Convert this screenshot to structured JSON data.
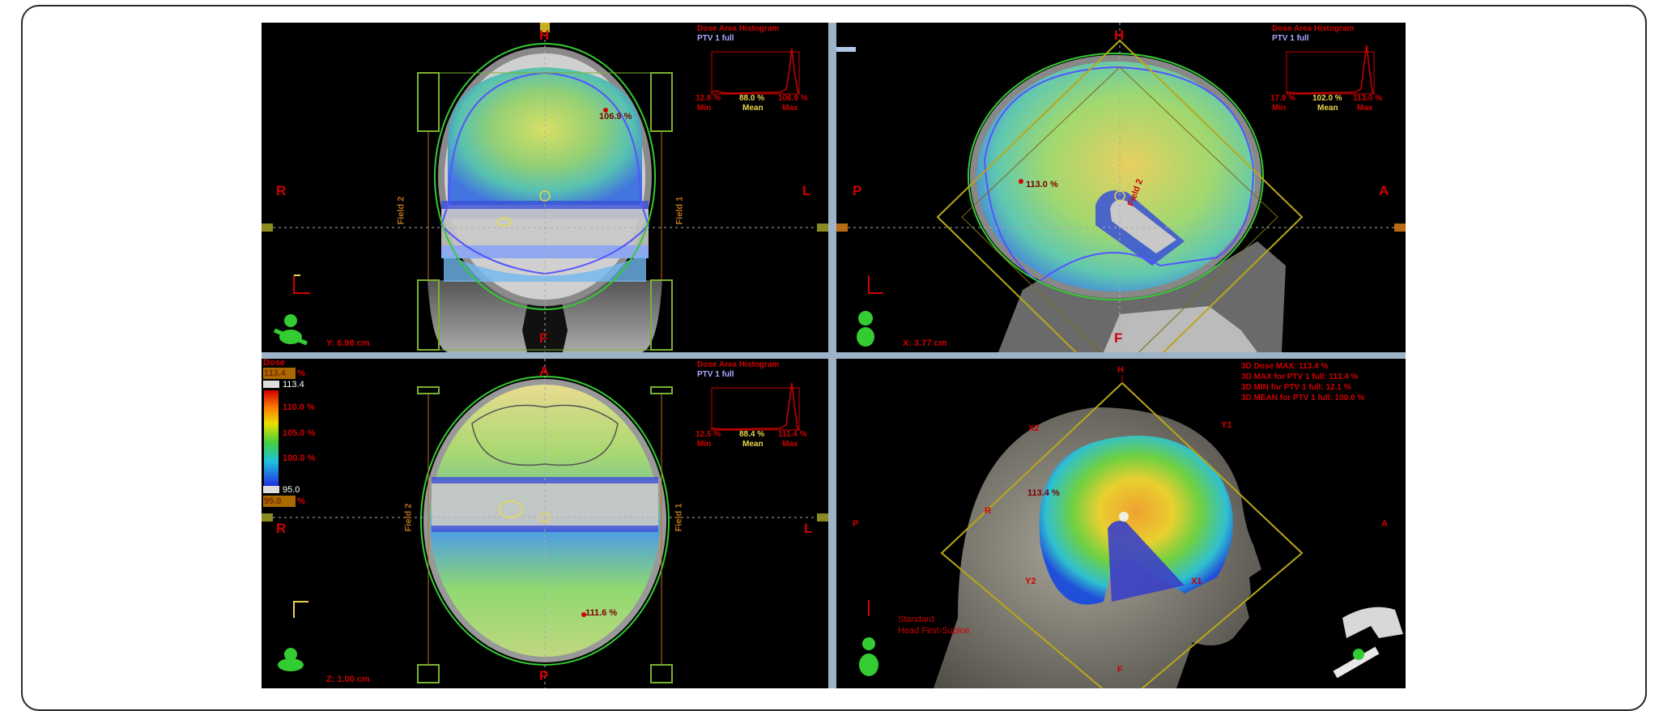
{
  "views": {
    "coronal": {
      "top": "H",
      "bottom": "F",
      "left": "R",
      "right": "L",
      "dah_title": "Dose Area Histogram",
      "dah_structure": "PTV 1 full",
      "min_value": "12.8 %",
      "mean_value": "88.0 %",
      "max_value": "106.9 %",
      "min_label": "Min",
      "mean_label": "Mean",
      "max_label": "Max",
      "point_dose": "106.9 %",
      "field_left": "Field 2",
      "field_right": "Field 1",
      "position": "Y: 6.98 cm"
    },
    "sagittal": {
      "top": "H",
      "bottom": "F",
      "left": "P",
      "right": "A",
      "dah_title": "Dose Area Histogram",
      "dah_structure": "PTV 1 full",
      "min_value": "17.9 %",
      "mean_value": "102.0 %",
      "max_value": "113.0 %",
      "min_label": "Min",
      "mean_label": "Mean",
      "max_label": "Max",
      "point_dose": "113.0 %",
      "field_label": "Field 2",
      "position": "X: 3.77 cm"
    },
    "axial": {
      "top": "A",
      "bottom": "P",
      "left": "R",
      "right": "L",
      "dah_title": "Dose Area Histogram",
      "dah_structure": "PTV 1 full",
      "min_value": "12.5 %",
      "mean_value": "88.4 %",
      "max_value": "111.4 %",
      "min_label": "Min",
      "mean_label": "Mean",
      "max_label": "Max",
      "point_dose": "111.6 %",
      "field_left": "Field 2",
      "field_right": "Field 1",
      "position": "Z: 1.00 cm"
    },
    "three_d": {
      "top": "H",
      "bottom": "F",
      "left": "P",
      "right": "A",
      "left_mid": "R",
      "jaw_labels": [
        "X2",
        "Y1",
        "Y2",
        "X1"
      ],
      "stats": [
        "3D Dose MAX: 113.4 %",
        "3D MAX for PTV 1 full: 113.4 %",
        "3D MIN for PTV 1 full: 12.1 %",
        "3D MEAN for PTV 1 full: 100.0 %"
      ],
      "point_dose": "113.4 %",
      "orientation_line1": "Standard",
      "orientation_line2": "Head First-Supine"
    }
  },
  "dose_legend": {
    "title": "Dose",
    "max_input": "113.4",
    "max_unit": "%",
    "max_value": "113.4",
    "ticks": [
      "110.0 %",
      "105.0 %",
      "100.0 %"
    ],
    "min_value": "95.0",
    "min_input": "95.0",
    "min_unit": "%"
  },
  "colors": {
    "label_red": "#d10000",
    "ptv_blue": "#a9a9ff",
    "body_green": "#33cc33",
    "mean_yellow": "#e8d44d",
    "field_yellow": "#b8a818"
  }
}
